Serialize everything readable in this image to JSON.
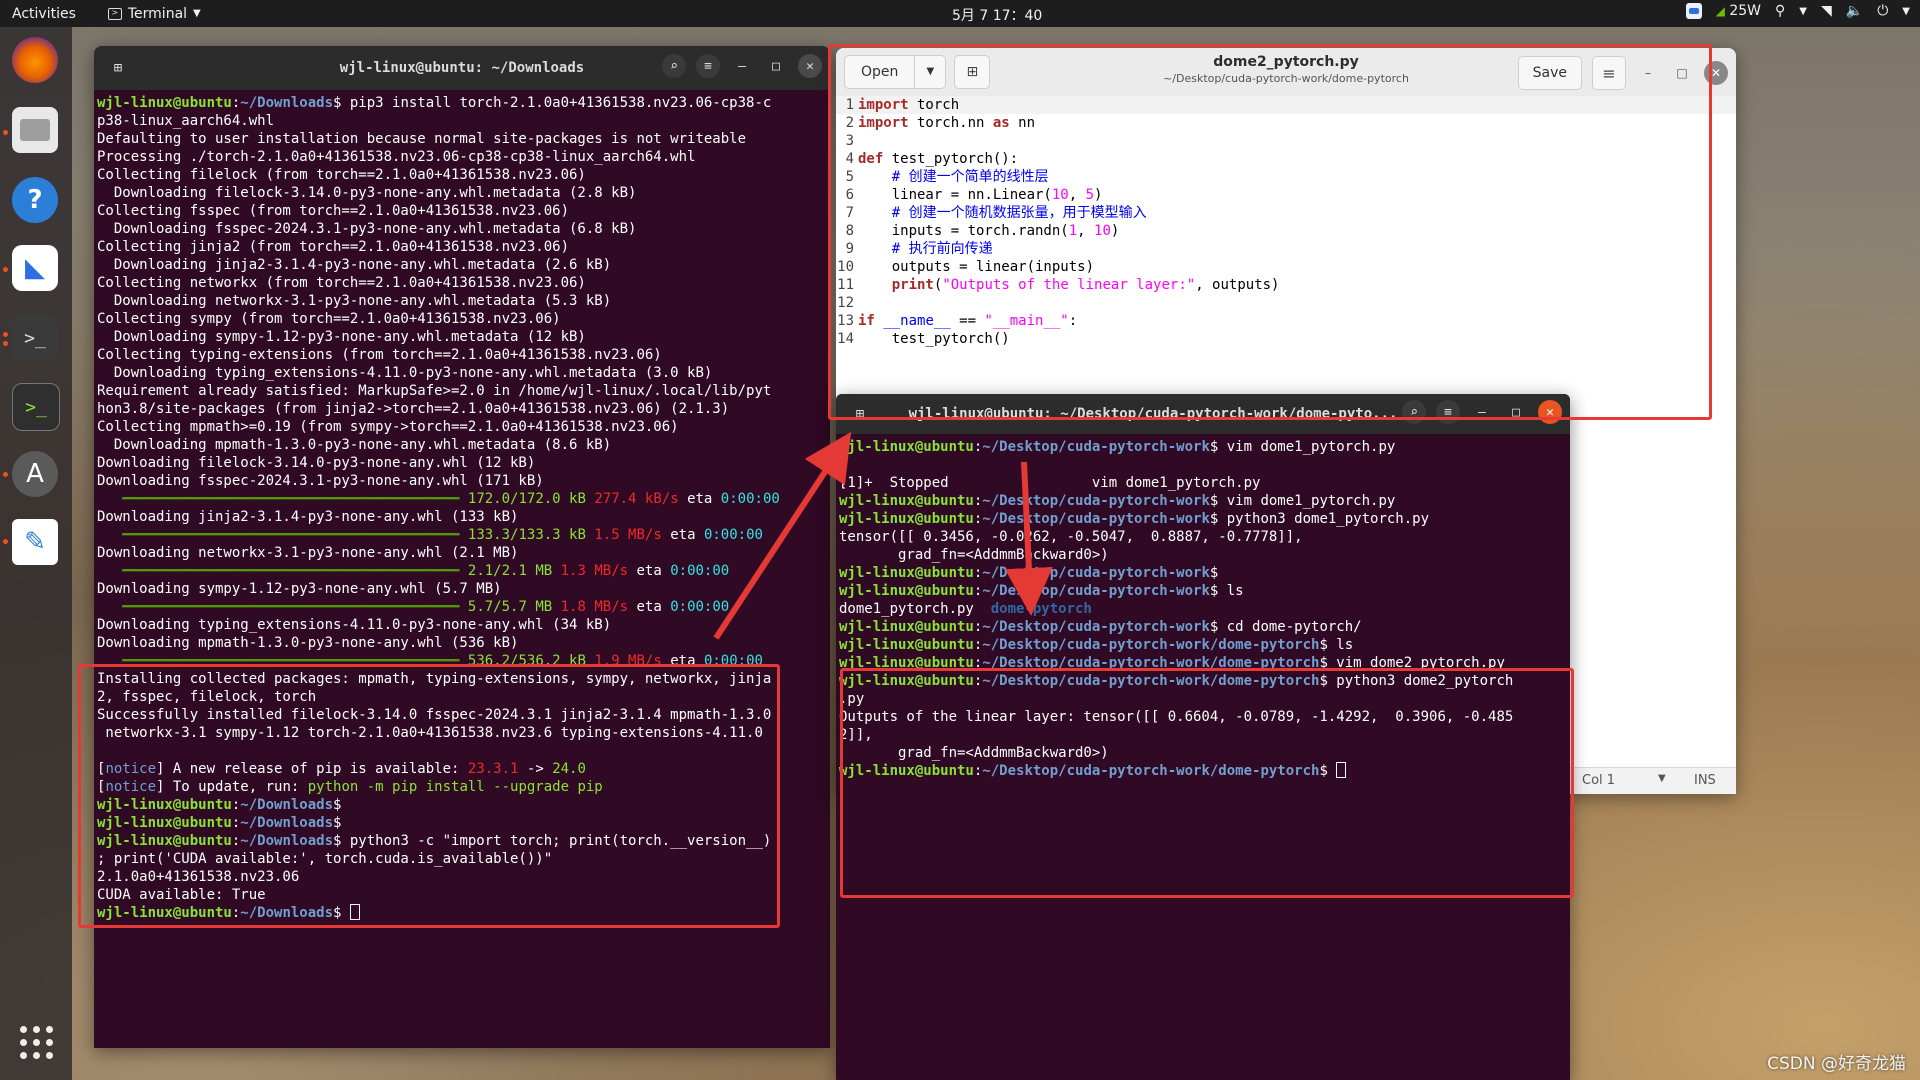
{
  "topbar": {
    "activities": "Activities",
    "app_name": "Terminal",
    "clock": "5月 7  17：40",
    "gpu_power": "25W"
  },
  "dock": {
    "items": [
      "firefox-icon",
      "files-icon",
      "help-icon",
      "feishu-icon",
      "terminal-icon",
      "terminal-icon",
      "software-center-icon",
      "text-editor-icon"
    ],
    "show_apps": "show-apps-icon"
  },
  "term1": {
    "title": "wjl-linux@ubuntu: ~/Downloads",
    "prompt_user": "wjl-linux@ubuntu",
    "prompt_path": "~/Downloads"
  },
  "term2": {
    "title": "wjl-linux@ubuntu: ~/Desktop/cuda-pytorch-work/dome-pyto...",
    "prompt_user": "wjl-linux@ubuntu",
    "path_work": "~/Desktop/cuda-pytorch-work",
    "path_dome": "~/Desktop/cuda-pytorch-work/dome-pytorch"
  },
  "editor": {
    "open_label": "Open",
    "save_label": "Save",
    "filename": "dome2_pytorch.py",
    "filepath": "~/Desktop/cuda-pytorch-work/dome-pytorch",
    "status_col": "Col 1",
    "status_mode": "INS"
  },
  "annotations": {
    "box_color": "#e53935",
    "arrow_color": "#e53935"
  },
  "watermark": "CSDN @好奇龙猫",
  "colors": {
    "terminal_bg": "#300a24",
    "prompt_user": "#8ae234",
    "prompt_path": "#729fcf",
    "accent": "#e95420"
  }
}
